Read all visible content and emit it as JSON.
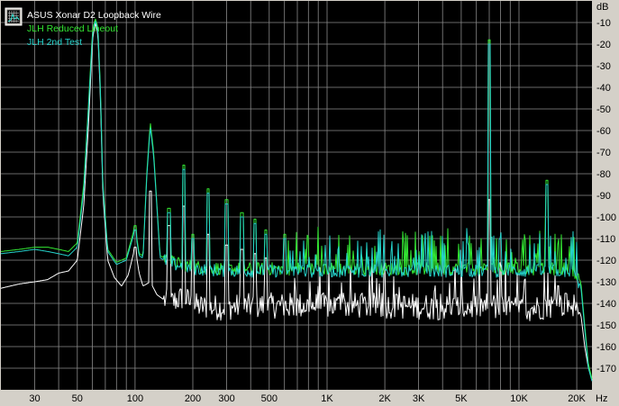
{
  "chart_data": {
    "type": "line",
    "title": "",
    "xlabel": "Hz",
    "ylabel": "dB",
    "x_scale": "log",
    "xlim": [
      20,
      24000
    ],
    "ylim": [
      -180,
      0
    ],
    "grid": true,
    "background": "#000000",
    "grid_color": "#8a8a8a",
    "legend_placement": "top-left",
    "x_ticks": [
      {
        "value": 30,
        "label": "30"
      },
      {
        "value": 50,
        "label": "50"
      },
      {
        "value": 100,
        "label": "100"
      },
      {
        "value": 200,
        "label": "200"
      },
      {
        "value": 300,
        "label": "300"
      },
      {
        "value": 500,
        "label": "500"
      },
      {
        "value": 1000,
        "label": "1K"
      },
      {
        "value": 2000,
        "label": "2K"
      },
      {
        "value": 3000,
        "label": "3K"
      },
      {
        "value": 5000,
        "label": "5K"
      },
      {
        "value": 10000,
        "label": "10K"
      },
      {
        "value": 20000,
        "label": "20K"
      }
    ],
    "x_minor_grid": [
      40,
      60,
      70,
      80,
      90,
      400,
      600,
      700,
      800,
      900,
      4000,
      6000,
      7000,
      8000,
      9000
    ],
    "y_ticks": [
      -10,
      -20,
      -30,
      -40,
      -50,
      -60,
      -70,
      -80,
      -90,
      -100,
      -110,
      -120,
      -130,
      -140,
      -150,
      -160,
      -170
    ],
    "series": [
      {
        "name": "ASUS Xonar D2 Loopback Wire",
        "color": "#ffffff",
        "floor_db": -143,
        "points": [
          [
            20,
            -133
          ],
          [
            25,
            -131
          ],
          [
            30,
            -130
          ],
          [
            35,
            -129
          ],
          [
            40,
            -126
          ],
          [
            45,
            -125
          ],
          [
            50,
            -120
          ],
          [
            54,
            -95
          ],
          [
            57,
            -60
          ],
          [
            60,
            -18
          ],
          [
            62,
            -10
          ],
          [
            64,
            -15
          ],
          [
            66,
            -45
          ],
          [
            68,
            -90
          ],
          [
            72,
            -120
          ],
          [
            78,
            -128
          ],
          [
            85,
            -132
          ],
          [
            92,
            -127
          ],
          [
            100,
            -114
          ],
          [
            105,
            -126
          ],
          [
            110,
            -132
          ],
          [
            120,
            -130
          ],
          [
            130,
            -136
          ],
          [
            150,
            -140
          ],
          [
            180,
            -137
          ],
          [
            200,
            -141
          ],
          [
            250,
            -142
          ],
          [
            500,
            -141
          ],
          [
            1000,
            -141
          ],
          [
            2000,
            -141
          ],
          [
            5000,
            -142
          ],
          [
            7000,
            -141
          ],
          [
            10000,
            -143
          ],
          [
            15000,
            -141
          ],
          [
            19000,
            -140
          ],
          [
            21000,
            -145
          ],
          [
            22000,
            -160
          ],
          [
            23000,
            -170
          ],
          [
            24000,
            -175
          ]
        ],
        "peaks": [
          [
            100,
            -114
          ],
          [
            120,
            -88
          ],
          [
            150,
            -104
          ],
          [
            180,
            -95
          ],
          [
            200,
            -110
          ],
          [
            240,
            -108
          ],
          [
            300,
            -113
          ],
          [
            360,
            -115
          ],
          [
            420,
            -117
          ],
          [
            480,
            -119
          ],
          [
            7000,
            -92
          ]
        ]
      },
      {
        "name": "JLH Reduced Lineout",
        "color": "#33e833",
        "floor_db": -125,
        "points": [
          [
            20,
            -116
          ],
          [
            25,
            -115
          ],
          [
            30,
            -114
          ],
          [
            35,
            -114
          ],
          [
            40,
            -115
          ],
          [
            45,
            -116
          ],
          [
            50,
            -112
          ],
          [
            54,
            -85
          ],
          [
            57,
            -50
          ],
          [
            60,
            -14
          ],
          [
            62,
            -8
          ],
          [
            64,
            -12
          ],
          [
            66,
            -40
          ],
          [
            68,
            -85
          ],
          [
            72,
            -115
          ],
          [
            80,
            -121
          ],
          [
            90,
            -119
          ],
          [
            100,
            -104
          ],
          [
            105,
            -117
          ],
          [
            110,
            -118
          ],
          [
            115,
            -80
          ],
          [
            120,
            -56
          ],
          [
            125,
            -70
          ],
          [
            135,
            -118
          ],
          [
            160,
            -121
          ],
          [
            200,
            -123
          ],
          [
            300,
            -124
          ],
          [
            500,
            -124
          ],
          [
            1000,
            -124
          ],
          [
            2000,
            -124
          ],
          [
            5000,
            -124
          ],
          [
            7000,
            -124
          ],
          [
            10000,
            -124
          ],
          [
            15000,
            -124
          ],
          [
            19000,
            -124
          ],
          [
            21000,
            -130
          ],
          [
            22000,
            -150
          ],
          [
            23000,
            -168
          ],
          [
            24000,
            -175
          ]
        ],
        "peaks": [
          [
            100,
            -104
          ],
          [
            150,
            -96
          ],
          [
            180,
            -76
          ],
          [
            200,
            -108
          ],
          [
            240,
            -87
          ],
          [
            300,
            -92
          ],
          [
            360,
            -98
          ],
          [
            420,
            -101
          ],
          [
            480,
            -106
          ],
          [
            600,
            -108
          ],
          [
            7000,
            -18
          ],
          [
            14000,
            -83
          ]
        ]
      },
      {
        "name": "JLH 2nd Test",
        "color": "#25d4cc",
        "floor_db": -125,
        "points": [
          [
            20,
            -117
          ],
          [
            25,
            -116
          ],
          [
            30,
            -115
          ],
          [
            35,
            -116
          ],
          [
            40,
            -117
          ],
          [
            45,
            -118
          ],
          [
            50,
            -114
          ],
          [
            54,
            -88
          ],
          [
            57,
            -52
          ],
          [
            60,
            -16
          ],
          [
            62,
            -9
          ],
          [
            64,
            -13
          ],
          [
            66,
            -42
          ],
          [
            68,
            -87
          ],
          [
            72,
            -116
          ],
          [
            80,
            -122
          ],
          [
            90,
            -120
          ],
          [
            100,
            -106
          ],
          [
            105,
            -118
          ],
          [
            110,
            -119
          ],
          [
            115,
            -82
          ],
          [
            120,
            -58
          ],
          [
            125,
            -72
          ],
          [
            135,
            -119
          ],
          [
            160,
            -122
          ],
          [
            200,
            -124
          ],
          [
            300,
            -125
          ],
          [
            500,
            -125
          ],
          [
            1000,
            -125
          ],
          [
            2000,
            -125
          ],
          [
            5000,
            -125
          ],
          [
            7000,
            -125
          ],
          [
            10000,
            -125
          ],
          [
            15000,
            -125
          ],
          [
            19000,
            -125
          ],
          [
            21000,
            -132
          ],
          [
            22000,
            -152
          ],
          [
            23000,
            -170
          ],
          [
            24000,
            -176
          ]
        ],
        "peaks": [
          [
            100,
            -106
          ],
          [
            150,
            -98
          ],
          [
            180,
            -78
          ],
          [
            200,
            -110
          ],
          [
            240,
            -89
          ],
          [
            300,
            -94
          ],
          [
            360,
            -100
          ],
          [
            420,
            -103
          ],
          [
            480,
            -108
          ],
          [
            600,
            -110
          ],
          [
            7000,
            -20
          ],
          [
            14000,
            -85
          ]
        ]
      }
    ]
  }
}
